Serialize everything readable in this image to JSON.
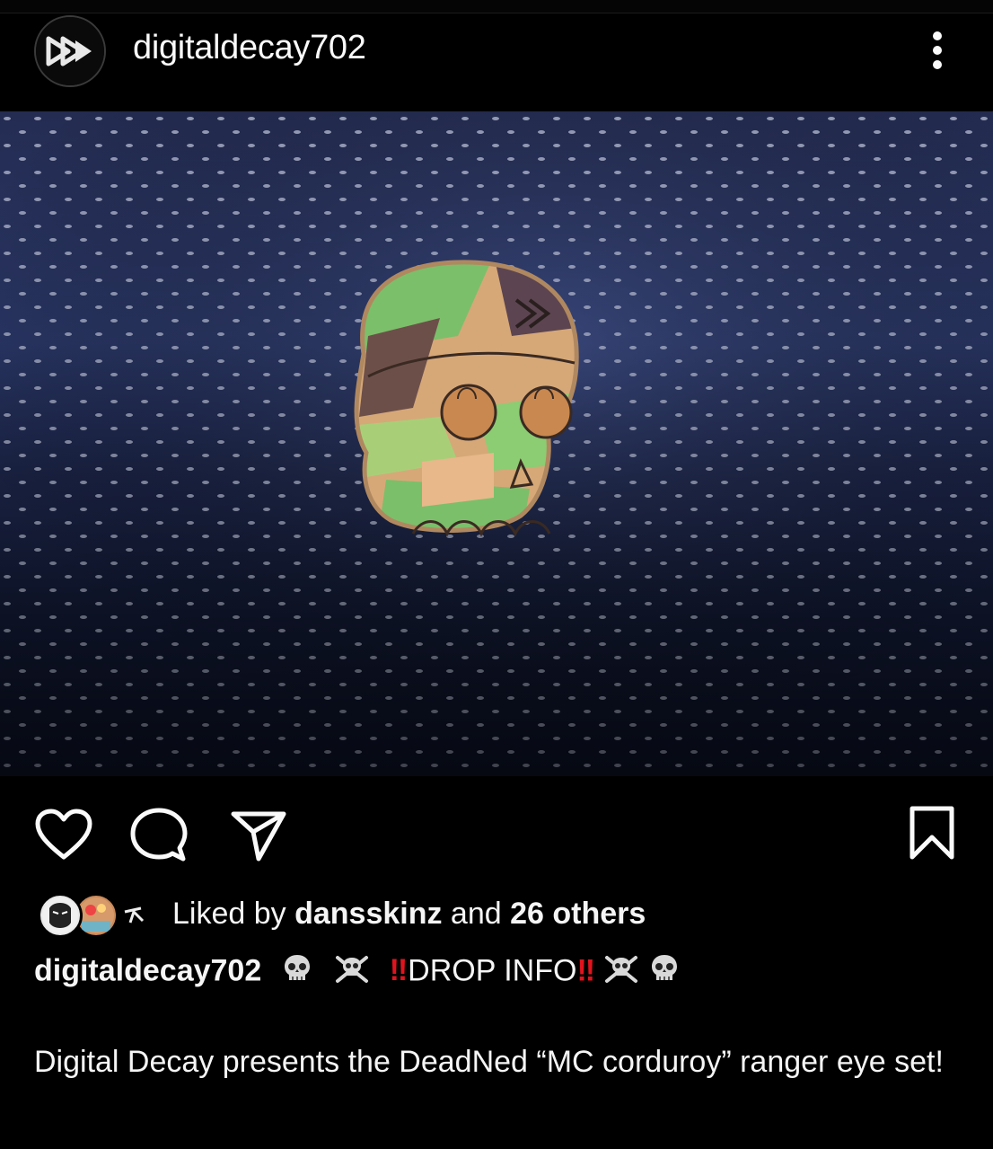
{
  "post": {
    "username": "digitaldecay702",
    "more_icon": "more-vertical-icon"
  },
  "actions": {
    "like_icon": "heart-icon",
    "comment_icon": "comment-icon",
    "share_icon": "send-icon",
    "save_icon": "bookmark-icon"
  },
  "likes": {
    "prefix": "Liked by ",
    "user": "dansskinz",
    "middle": " and ",
    "count": "26 others"
  },
  "caption": {
    "username": "digitaldecay702",
    "drop_text": "DROP INFO",
    "bang": "‼",
    "body": "Digital Decay presents the DeadNed “MC corduroy” ranger eye set!"
  },
  "colors": {
    "background": "#000000",
    "text": "#f5f5f5",
    "accent_red": "#e0141e"
  }
}
